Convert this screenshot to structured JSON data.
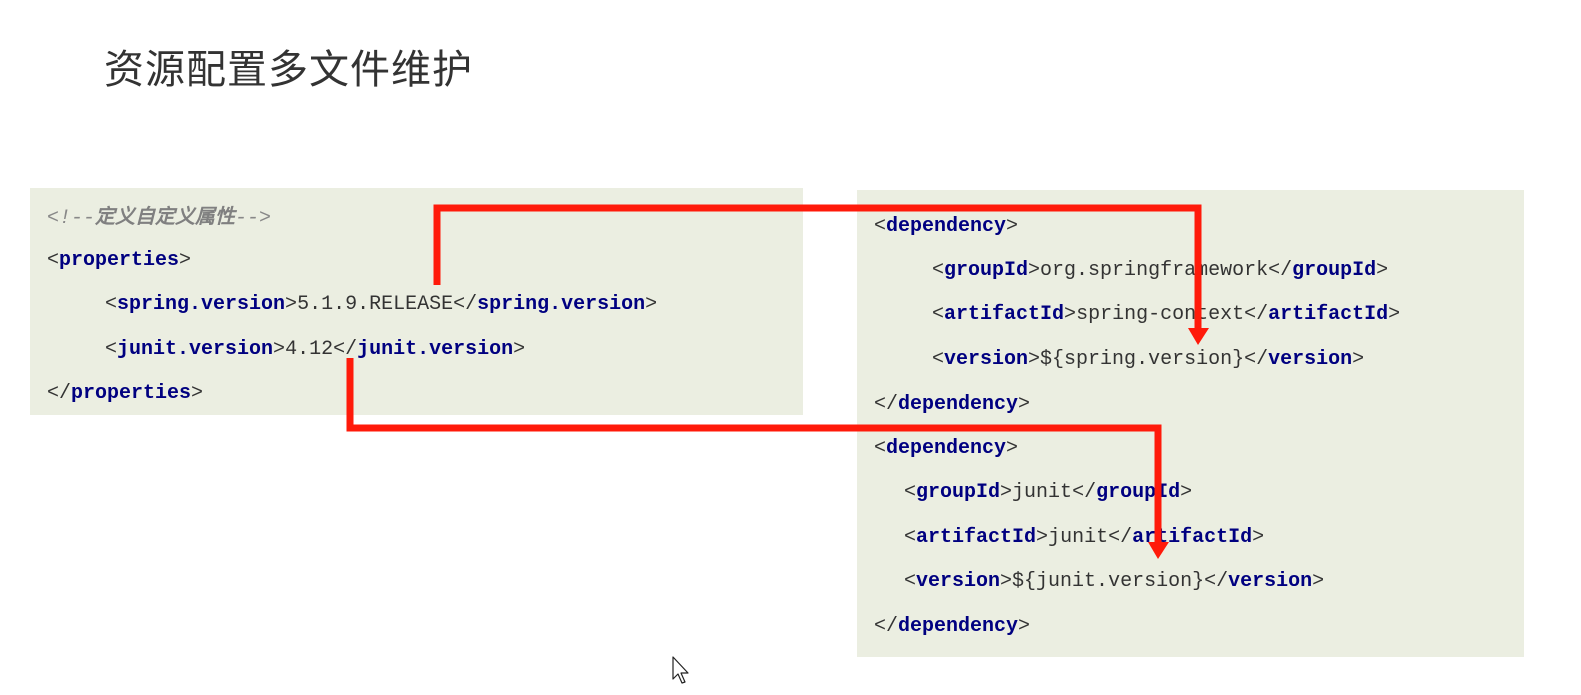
{
  "slide": {
    "title": "资源配置多文件维护"
  },
  "left_code": {
    "comment_open": "<!--",
    "comment_text": "定义自定义属性",
    "comment_close": "-->",
    "properties_tag": "properties",
    "spring_tag": "spring.version",
    "spring_value": "5.1.9.RELEASE",
    "junit_tag": "junit.version",
    "junit_value": "4.12"
  },
  "right_code": {
    "dependency_tag": "dependency",
    "groupId_tag": "groupId",
    "artifactId_tag": "artifactId",
    "version_tag": "version",
    "spring_group": "org.springframework",
    "spring_artifact": "spring-context",
    "spring_version_ref": "${spring.version}",
    "junit_group": "junit",
    "junit_artifact": "junit",
    "junit_version_ref": "${junit.version}"
  },
  "colors": {
    "tag": "#000080",
    "panel_bg": "#ebeee1",
    "arrow": "#ff1a0a",
    "comment": "#888888"
  },
  "icons": [
    "mouse-cursor-icon"
  ]
}
